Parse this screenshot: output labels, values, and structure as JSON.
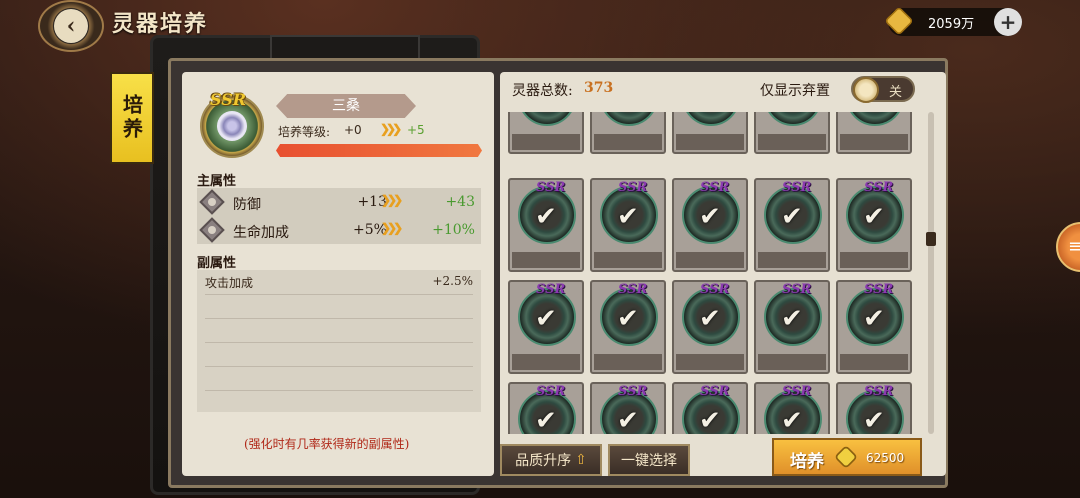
{
  "header": {
    "title": "灵器培养",
    "back_icon": "back-arrow-icon",
    "currency_value": "2059万",
    "plus_label": "+"
  },
  "side_tab": {
    "label": "培养"
  },
  "item": {
    "rarity": "SSR",
    "name": "三桑",
    "level_label": "培养等级:",
    "level_current": "+0",
    "level_new": "+5"
  },
  "main_attrs": {
    "title": "主属性",
    "rows": [
      {
        "name": "防御",
        "current": "+13",
        "new": "+43"
      },
      {
        "name": "生命加成",
        "current": "+5%",
        "new": "+10%"
      }
    ]
  },
  "sub_attrs": {
    "title": "副属性",
    "rows": [
      {
        "name": "攻击加成",
        "value": "+2.5%"
      }
    ]
  },
  "hint": "(强化时有几率获得新的副属性)",
  "inventory": {
    "total_label": "灵器总数:",
    "total_value": "373",
    "filter_label": "仅显示弃置",
    "toggle_state": "关",
    "cell_rarity": "SSR",
    "check_glyph": "✔"
  },
  "buttons": {
    "sort_label": "品质升序",
    "select_label": "一键选择",
    "cultivate_label": "培养",
    "cultivate_cost": "62500"
  },
  "colors": {
    "accent_gold": "#e8b840",
    "increase_green": "#4a9a30",
    "hint_red": "#b02818",
    "total_orange": "#c87020"
  }
}
